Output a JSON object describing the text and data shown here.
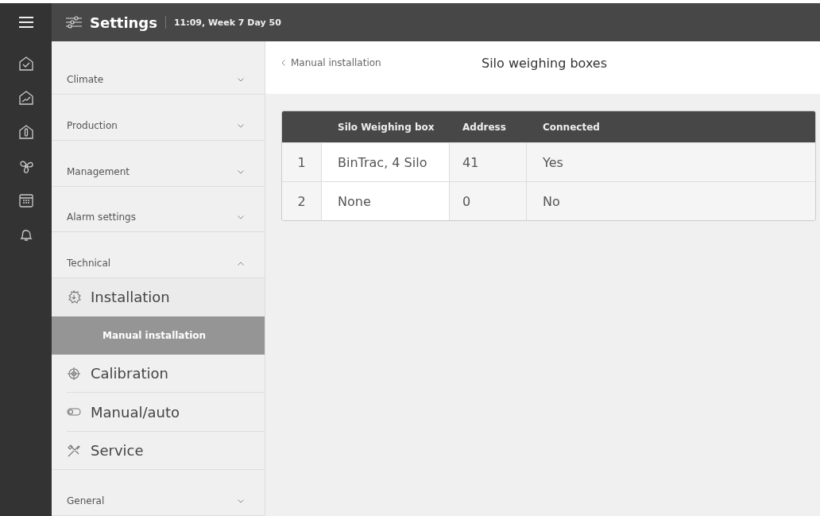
{
  "header": {
    "title": "Settings",
    "time": "11:09, Week 7 Day 50"
  },
  "rail": [
    {
      "kind": "house-check"
    },
    {
      "kind": "house-graph"
    },
    {
      "kind": "house-thermo"
    },
    {
      "kind": "fan"
    },
    {
      "kind": "calendar"
    },
    {
      "kind": "bell"
    }
  ],
  "sidebar": {
    "categories": [
      {
        "label": "Climate",
        "expanded": false
      },
      {
        "label": "Production",
        "expanded": false
      },
      {
        "label": "Management",
        "expanded": false
      },
      {
        "label": "Alarm settings",
        "expanded": false
      },
      {
        "label": "Technical",
        "expanded": true,
        "children": [
          {
            "label": "Installation",
            "kind": "gear",
            "expanded": true,
            "children": [
              {
                "label": "Manual installation",
                "selected": true
              }
            ]
          },
          {
            "label": "Calibration",
            "kind": "target",
            "expanded": false
          },
          {
            "label": "Manual/auto",
            "kind": "toggle",
            "expanded": false
          },
          {
            "label": "Service",
            "kind": "tools",
            "expanded": false
          }
        ]
      },
      {
        "label": "General",
        "expanded": false
      }
    ]
  },
  "breadcrumb": {
    "back": "Manual installation",
    "title": "Silo weighing boxes"
  },
  "table": {
    "columns": [
      "Silo Weighing box",
      "Address",
      "Connected"
    ],
    "rows": [
      {
        "index": "1",
        "cells": [
          "BinTrac, 4 Silo",
          "41",
          "Yes"
        ]
      },
      {
        "index": "2",
        "cells": [
          "None",
          "0",
          "No"
        ]
      }
    ]
  }
}
